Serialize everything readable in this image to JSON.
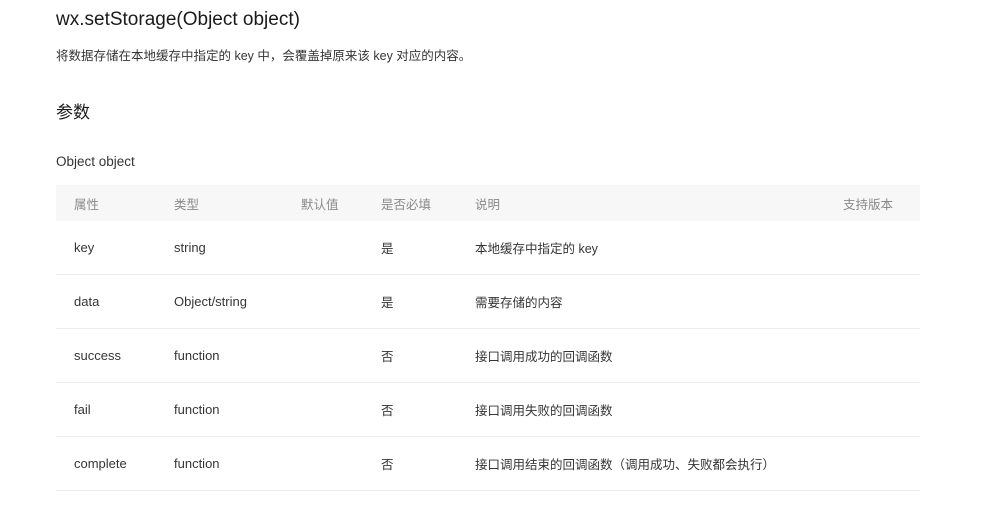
{
  "api": {
    "title": "wx.setStorage(Object object)",
    "description": "将数据存储在本地缓存中指定的 key 中，会覆盖掉原来该 key 对应的内容。"
  },
  "params_section": {
    "heading": "参数",
    "object_name": "Object object"
  },
  "table": {
    "headers": {
      "property": "属性",
      "type": "类型",
      "default": "默认值",
      "required": "是否必填",
      "description": "说明",
      "version": "支持版本"
    },
    "rows": [
      {
        "property": "key",
        "type": "string",
        "default": "",
        "required": "是",
        "description": "本地缓存中指定的 key",
        "version": ""
      },
      {
        "property": "data",
        "type": "Object/string",
        "default": "",
        "required": "是",
        "description": "需要存储的内容",
        "version": ""
      },
      {
        "property": "success",
        "type": "function",
        "default": "",
        "required": "否",
        "description": "接口调用成功的回调函数",
        "version": ""
      },
      {
        "property": "fail",
        "type": "function",
        "default": "",
        "required": "否",
        "description": "接口调用失败的回调函数",
        "version": ""
      },
      {
        "property": "complete",
        "type": "function",
        "default": "",
        "required": "否",
        "description": "接口调用结束的回调函数（调用成功、失败都会执行）",
        "version": ""
      }
    ]
  }
}
